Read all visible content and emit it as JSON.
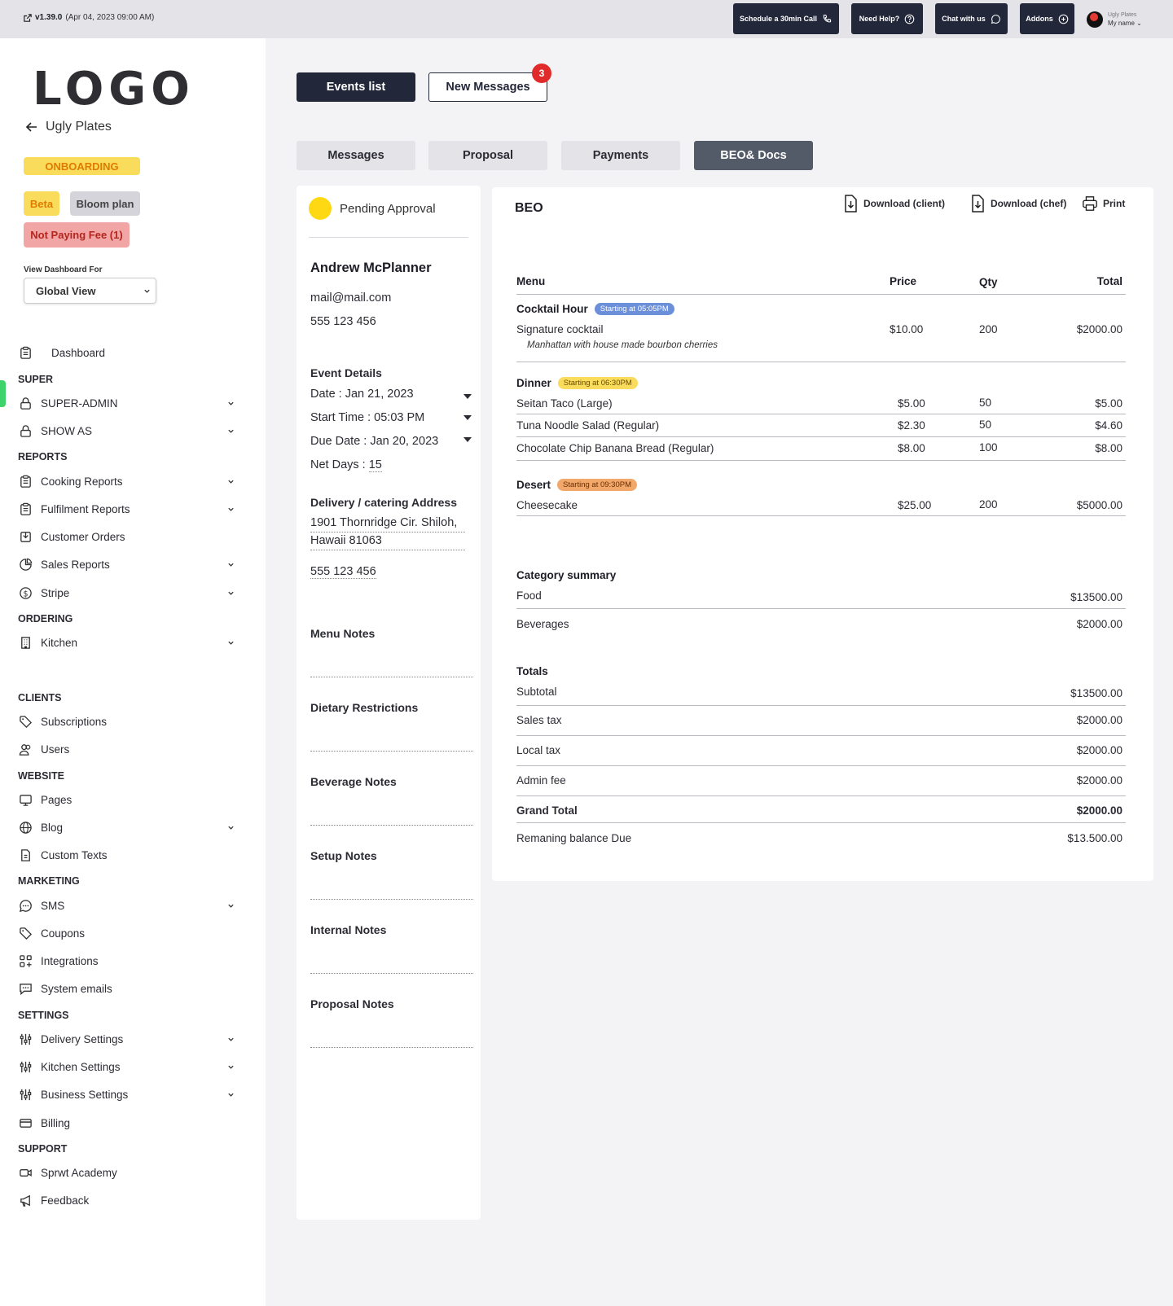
{
  "topbar": {
    "version": "v1.39.0",
    "version_date": "(Apr 04, 2023 09:00 AM)",
    "schedule_call": "Schedule a 30min Call",
    "need_help": "Need Help?",
    "chat": "Chat with us",
    "addons": "Addons",
    "user_org": "Ugly Plates",
    "user_name": "My name"
  },
  "sidebar": {
    "logo": "LOGO",
    "back_label": "Ugly Plates",
    "onboarding": "ONBOARDING",
    "beta": "Beta",
    "plan": "Bloom plan",
    "not_paying": "Not Paying Fee (1)",
    "view_for_label": "View Dashboard For",
    "view_for_value": "Global View",
    "sections": {
      "super": "SUPER",
      "reports": "REPORTS",
      "ordering": "ORDERING",
      "clients": "CLIENTS",
      "website": "WEBSITE",
      "marketing": "MARKETING",
      "settings": "SETTINGS",
      "support": "SUPPORT"
    },
    "items": {
      "dashboard": "Dashboard",
      "super_admin": "SUPER-ADMIN",
      "show_as": "SHOW AS",
      "cooking_reports": "Cooking Reports",
      "fulfilment_reports": "Fulfilment Reports",
      "customer_orders": "Customer Orders",
      "sales_reports": "Sales Reports",
      "stripe": "Stripe",
      "kitchen": "Kitchen",
      "subscriptions": "Subscriptions",
      "users": "Users",
      "pages": "Pages",
      "blog": "Blog",
      "custom_texts": "Custom Texts",
      "sms": "SMS",
      "coupons": "Coupons",
      "integrations": "Integrations",
      "system_emails": "System emails",
      "delivery_settings": "Delivery Settings",
      "kitchen_settings": "Kitchen Settings",
      "business_settings": "Business Settings",
      "billing": "Billing",
      "academy": "Sprwt Academy",
      "feedback": "Feedback"
    }
  },
  "main": {
    "events_list": "Events list",
    "new_messages": "New Messages",
    "new_messages_count": "3",
    "tabs": {
      "messages": "Messages",
      "proposal": "Proposal",
      "payments": "Payments",
      "beo_docs": "BEO& Docs"
    }
  },
  "client": {
    "status": "Pending Approval",
    "name": "Andrew McPlanner",
    "email": "mail@mail.com",
    "phone": "555 123 456",
    "event_details_head": "Event Details",
    "date": "Date : Jan 21, 2023",
    "start_time": "Start Time : 05:03 PM",
    "due_date": "Due Date : Jan 20, 2023",
    "net_days_label": "Net Days : ",
    "net_days_value": "15",
    "address_head": "Delivery / catering Address",
    "address_line1": "1901 Thornridge Cir. Shiloh,",
    "address_line2": "Hawaii 81063",
    "address_phone": "555 123 456",
    "notes": {
      "menu": "Menu Notes",
      "dietary": "Dietary Restrictions",
      "beverage": "Beverage Notes",
      "setup": "Setup Notes",
      "internal": "Internal Notes",
      "proposal": "Proposal Notes"
    }
  },
  "beo": {
    "title": "BEO",
    "download_client": "Download (client)",
    "download_chef": "Download (chef)",
    "print": "Print",
    "columns": {
      "menu": "Menu",
      "price": "Price",
      "qty": "Qty",
      "total": "Total"
    },
    "cocktail": {
      "name": "Cocktail Hour",
      "start": "Starting at  05:05PM",
      "item": "Signature cocktail",
      "desc": "Manhattan with house made bourbon cherries",
      "price": "$10.00",
      "qty": "200",
      "total": "$2000.00"
    },
    "dinner": {
      "name": "Dinner",
      "start": "Starting at  06:30PM",
      "rows": [
        {
          "item": "Seitan Taco (Large)",
          "price": "$5.00",
          "qty": "50",
          "total": "$5.00"
        },
        {
          "item": "Tuna Noodle Salad (Regular)",
          "price": "$2.30",
          "qty": "50",
          "total": "$4.60"
        },
        {
          "item": "Chocolate Chip Banana Bread (Regular)",
          "price": "$8.00",
          "qty": "100",
          "total": "$8.00"
        }
      ]
    },
    "desert": {
      "name": "Desert",
      "start": "Starting at  09:30PM",
      "item": "Cheesecake",
      "price": "$25.00",
      "qty": "200",
      "total": "$5000.00"
    },
    "category_summary": {
      "head": "Category summary",
      "food_label": "Food",
      "food_value": "$13500.00",
      "bev_label": "Beverages",
      "bev_value": "$2000.00"
    },
    "totals": {
      "head": "Totals",
      "subtotal_label": "Subtotal",
      "subtotal_value": "$13500.00",
      "sales_tax_label": "Sales tax",
      "sales_tax_value": "$2000.00",
      "local_tax_label": "Local tax",
      "local_tax_value": "$2000.00",
      "admin_fee_label": "Admin fee",
      "admin_fee_value": "$2000.00",
      "grand_total_label": "Grand Total",
      "grand_total_value": "$2000.00",
      "balance_label": "Remaning balance Due",
      "balance_value": "$13.500.00"
    }
  }
}
